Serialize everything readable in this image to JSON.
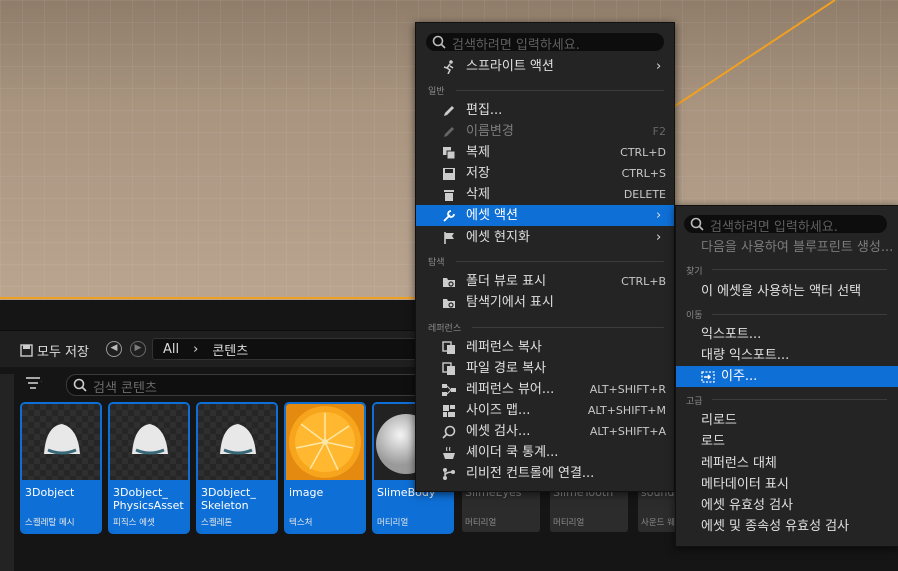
{
  "toolbar": {
    "save_all": "모두 저장",
    "path_all": "All",
    "path_sep": "›",
    "path_folder": "콘텐츠"
  },
  "content_search": {
    "placeholder": "검색 콘텐츠"
  },
  "assets": [
    {
      "name": "3Dobject",
      "type": "스켈레탈 메시",
      "stripe": "#e35ef0"
    },
    {
      "name": "3Dobject_ PhysicsAsset",
      "type": "피직스 에셋",
      "stripe": "#e6e14a"
    },
    {
      "name": "3Dobject_ Skeleton",
      "type": "스켈레톤",
      "stripe": "#5fd6e8"
    },
    {
      "name": "image",
      "type": "텍스처",
      "stripe": "#c43a3a"
    },
    {
      "name": "SlimeBody",
      "type": "머티리얼",
      "stripe": "#3fa13a"
    },
    {
      "name": "SlimeEyes",
      "type": "머티리얼"
    },
    {
      "name": "SlimeTooth",
      "type": "머티리얼"
    },
    {
      "name": "sound",
      "type": "사운드 웨"
    }
  ],
  "context_menu": {
    "search_placeholder": "검색하려면 입력하세요.",
    "sprite_actions": "스프라이트 액션",
    "section_general": "일반",
    "edit": "편집...",
    "rename": "이름변경",
    "rename_sc": "F2",
    "duplicate": "복제",
    "duplicate_sc": "CTRL+D",
    "save": "저장",
    "save_sc": "CTRL+S",
    "delete": "삭제",
    "delete_sc": "DELETE",
    "asset_actions": "에셋 액션",
    "asset_localization": "에셋 현지화",
    "section_explore": "탐색",
    "show_folder_view": "폴더 뷰로 표시",
    "show_folder_view_sc": "CTRL+B",
    "show_in_explorer": "탐색기에서 표시",
    "section_references": "레퍼런스",
    "copy_reference": "레퍼런스 복사",
    "copy_file_path": "파일 경로 복사",
    "reference_viewer": "레퍼런스 뷰어...",
    "reference_viewer_sc": "ALT+SHIFT+R",
    "size_map": "사이즈 맵...",
    "size_map_sc": "ALT+SHIFT+M",
    "audit_assets": "에셋 검사...",
    "audit_assets_sc": "ALT+SHIFT+A",
    "shader_cook_stats": "셰이더 쿡 통계...",
    "connect_revision_control": "리비전 컨트롤에 연결..."
  },
  "submenu": {
    "search_placeholder": "검색하려면 입력하세요.",
    "create_blueprint": "다음을 사용하여 블루프린트 생성...",
    "section_find": "찾기",
    "select_actors": "이 에셋을 사용하는 액터 선택",
    "section_move": "이동",
    "export": "익스포트...",
    "bulk_export": "대량 익스포트...",
    "migrate": "이주...",
    "section_advanced": "고급",
    "reload": "리로드",
    "load": "로드",
    "replace_references": "레퍼런스 대체",
    "show_metadata": "메타데이터 표시",
    "validate_assets": "에셋 유효성 검사",
    "validate_assets_deps": "에셋 및 종속성 유효성 검사"
  }
}
